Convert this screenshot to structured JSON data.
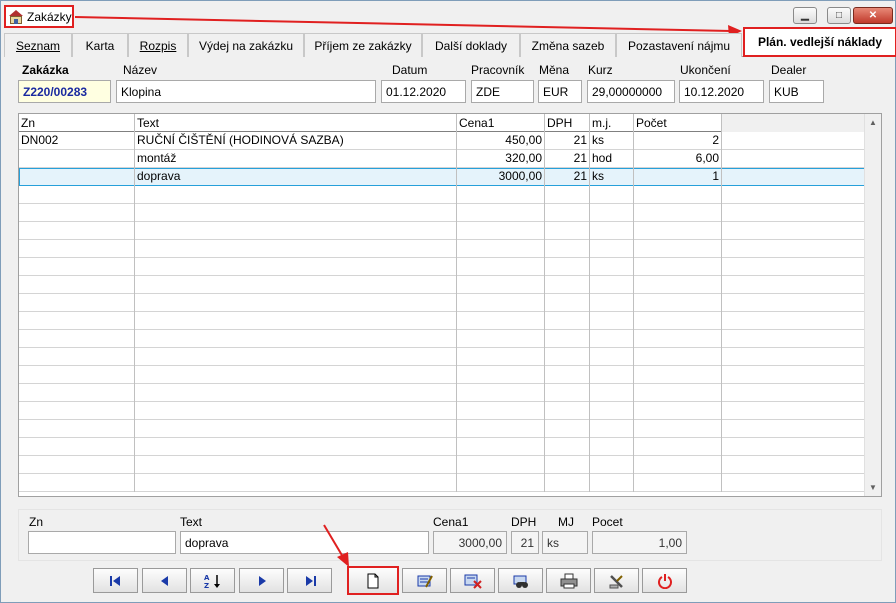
{
  "window": {
    "title": "Zakázky",
    "min_glyph": "▁",
    "max_glyph": "□",
    "close_glyph": "✕"
  },
  "tabs": [
    {
      "label": "Seznam"
    },
    {
      "label": "Karta"
    },
    {
      "label": "Rozpis"
    },
    {
      "label": "Výdej na zakázku"
    },
    {
      "label": "Příjem ze zakázky"
    },
    {
      "label": "Další doklady"
    },
    {
      "label": "Změna sazeb"
    },
    {
      "label": "Pozastavení nájmu"
    },
    {
      "label": "Plán. vedlejší náklady",
      "active": true
    }
  ],
  "header": {
    "labels": {
      "zakazka": "Zakázka",
      "nazev": "Název",
      "datum": "Datum",
      "pracovnik": "Pracovník",
      "mena": "Měna",
      "kurz": "Kurz",
      "ukonceni": "Ukončení",
      "dealer": "Dealer"
    },
    "values": {
      "zakazka": "Z220/00283",
      "nazev": "Klopina",
      "datum": "01.12.2020",
      "pracovnik": "ZDE",
      "mena": "EUR",
      "kurz": "29,00000000",
      "ukonceni": "10.12.2020",
      "dealer": "KUB"
    }
  },
  "grid": {
    "columns": [
      "Zn",
      "Text",
      "Cena1",
      "DPH",
      "m.j.",
      "Počet"
    ],
    "rows": [
      {
        "zn": "DN002",
        "text": "RUČNÍ ČIŠTĚNÍ (HODINOVÁ SAZBA)",
        "cena1": "450,00",
        "dph": "21",
        "mj": "ks",
        "pocet": "2"
      },
      {
        "zn": "",
        "text": "montáž",
        "cena1": "320,00",
        "dph": "21",
        "mj": "hod",
        "pocet": "6,00"
      },
      {
        "zn": "",
        "text": "doprava",
        "cena1": "3000,00",
        "dph": "21",
        "mj": "ks",
        "pocet": "1",
        "selected": true
      }
    ],
    "empty_rows": 17
  },
  "detail": {
    "labels": {
      "zn": "Zn",
      "text": "Text",
      "cena1": "Cena1",
      "dph": "DPH",
      "mj": "MJ",
      "pocet": "Pocet"
    },
    "values": {
      "zn": "",
      "text": "doprava",
      "cena1": "3000,00",
      "dph": "21",
      "mj": "ks",
      "pocet": "1,00"
    }
  },
  "toolbar": [
    {
      "name": "first-record-button",
      "icon": "first-icon"
    },
    {
      "name": "previous-record-button",
      "icon": "previous-icon"
    },
    {
      "name": "sort-button",
      "icon": "sort-az-icon"
    },
    {
      "name": "next-record-button",
      "icon": "next-icon"
    },
    {
      "name": "last-record-button",
      "icon": "last-icon"
    },
    {
      "name": "new-record-button",
      "icon": "new-document-icon",
      "highlighted": true
    },
    {
      "name": "edit-record-button",
      "icon": "edit-icon"
    },
    {
      "name": "delete-record-button",
      "icon": "delete-icon"
    },
    {
      "name": "find-button",
      "icon": "binoculars-icon"
    },
    {
      "name": "print-button",
      "icon": "printer-icon"
    },
    {
      "name": "tools-button",
      "icon": "tools-icon"
    },
    {
      "name": "close-button",
      "icon": "power-icon"
    }
  ],
  "colors": {
    "highlight": "#e02020",
    "accent_text": "#1a2aa0",
    "selection": "#e5f3fb",
    "required_field": "#ffffe1"
  }
}
